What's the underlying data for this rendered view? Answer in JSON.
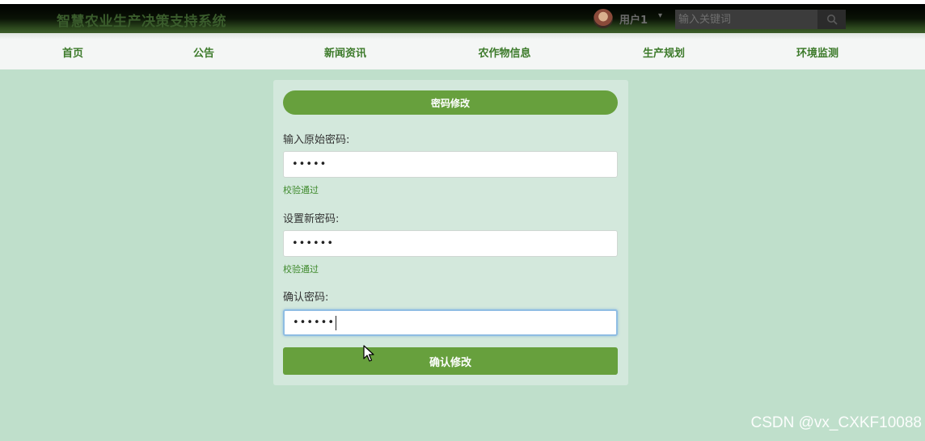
{
  "header": {
    "app_title": "智慧农业生产决策支持系统",
    "user_name": "用户1",
    "user_caret": "▾",
    "search_placeholder": "输入关键词"
  },
  "nav": {
    "items": [
      {
        "label": "首页"
      },
      {
        "label": "公告"
      },
      {
        "label": "新闻资讯"
      },
      {
        "label": "农作物信息"
      },
      {
        "label": "生产规划"
      },
      {
        "label": "环境监测"
      }
    ]
  },
  "form": {
    "title": "密码修改",
    "fields": [
      {
        "label": "输入原始密码:",
        "value": "•••••",
        "validation": "校验通过"
      },
      {
        "label": "设置新密码:",
        "value": "••••••",
        "validation": "校验通过"
      },
      {
        "label": "确认密码:",
        "value": "••••••"
      }
    ],
    "submit_label": "确认修改"
  },
  "watermark": "CSDN @vx_CXKF10088",
  "colors": {
    "page_bg": "#bfdfcb",
    "accent": "#67a03d",
    "nav_text": "#3c7a2a",
    "valid_text": "#3f8a2c"
  }
}
